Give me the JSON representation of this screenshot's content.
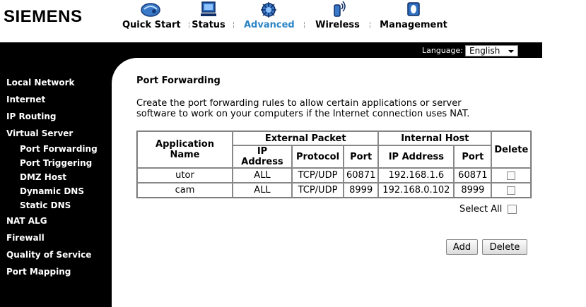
{
  "brand": "SIEMENS",
  "nav": [
    {
      "label": "Quick Start",
      "icon": "quick-start-icon"
    },
    {
      "label": "Status",
      "icon": "monitor-icon"
    },
    {
      "label": "Advanced",
      "icon": "advanced-icon",
      "active": true
    },
    {
      "label": "Wireless",
      "icon": "wireless-icon"
    },
    {
      "label": "Management",
      "icon": "management-icon"
    }
  ],
  "language": {
    "label": "Language:",
    "value": "English"
  },
  "sidebar": {
    "items": [
      "Local Network",
      "Internet",
      "IP Routing",
      "Virtual Server",
      "Port Forwarding",
      "Port Triggering",
      "DMZ Host",
      "Dynamic DNS",
      "Static DNS",
      "NAT ALG",
      "Firewall",
      "Quality of Service",
      "Port Mapping"
    ]
  },
  "page": {
    "title": "Port Forwarding",
    "description_line1": "Create the port forwarding rules to allow certain applications or server",
    "description_line2": "software to work on your computers if the Internet connection uses NAT."
  },
  "table": {
    "headers": {
      "app_name": "Application Name",
      "external": "External Packet",
      "internal": "Internal Host",
      "delete": "Delete",
      "ip_address": "IP Address",
      "protocol": "Protocol",
      "port": "Port",
      "int_ip_address": "IP Address",
      "int_port": "Port"
    },
    "rows": [
      {
        "name": "utor",
        "ext_ip": "ALL",
        "protocol": "TCP/UDP",
        "ext_port": "60871",
        "int_ip": "192.168.1.6",
        "int_port": "60871",
        "delete": false
      },
      {
        "name": "cam",
        "ext_ip": "ALL",
        "protocol": "TCP/UDP",
        "ext_port": "8999",
        "int_ip": "192.168.0.102",
        "int_port": "8999",
        "delete": false
      }
    ]
  },
  "select_all_label": "Select All",
  "buttons": {
    "add": "Add",
    "delete": "Delete"
  },
  "colors": {
    "active_nav": "#2b84c6",
    "frame": "#000000"
  }
}
